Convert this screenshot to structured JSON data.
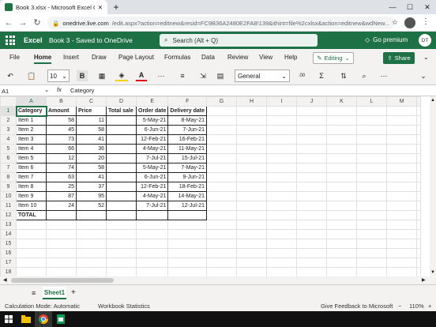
{
  "browser": {
    "tab_title": "Book 3.xlsx - Microsoft Excel Online",
    "new_tab_symbol": "+",
    "url_host": "onedrive.live.com",
    "url_path": "/edit.aspx?action=editnew&resid=FC9B36A2480E2FA8!139&ithint=file%2cxlsx&action=editnew&wdNew..."
  },
  "office": {
    "app_name": "Excel",
    "doc_name": "Book 3 - Saved to OneDrive",
    "search_placeholder": "Search (Alt + Q)",
    "premium_label": "Go premium",
    "avatar_initials": "DT"
  },
  "ribbon": {
    "tabs": [
      "File",
      "Home",
      "Insert",
      "Draw",
      "Page Layout",
      "Formulas",
      "Data",
      "Review",
      "View",
      "Help"
    ],
    "active_tab": "Home",
    "editing_label": "Editing",
    "share_label": "Share",
    "font_size": "10",
    "number_format": "General",
    "bold_label": "B"
  },
  "formula_bar": {
    "name_box": "A1",
    "fx_label": "fx",
    "content": "Category"
  },
  "grid": {
    "columns": [
      "A",
      "B",
      "C",
      "D",
      "E",
      "F",
      "G",
      "H",
      "I",
      "J",
      "K",
      "L",
      "M"
    ],
    "header_row": [
      "Category",
      "Amount",
      "Price",
      "Total sale",
      "Order date",
      "Delivery date"
    ],
    "rows": [
      [
        "Item 1",
        "58",
        "11",
        "",
        "5-May-21",
        "8-May-21"
      ],
      [
        "Item 2",
        "45",
        "58",
        "",
        "6-Jun-21",
        "7-Jun-21"
      ],
      [
        "Item 3",
        "73",
        "41",
        "",
        "12-Feb-21",
        "16-Feb-21"
      ],
      [
        "Item 4",
        "66",
        "36",
        "",
        "4-May-21",
        "11-May-21"
      ],
      [
        "Item 5",
        "12",
        "20",
        "",
        "7-Jul-21",
        "15-Jul-21"
      ],
      [
        "Item 6",
        "74",
        "58",
        "",
        "5-May-21",
        "7-May-21"
      ],
      [
        "Item 7",
        "63",
        "41",
        "",
        "6-Jun-21",
        "9-Jun-21"
      ],
      [
        "Item 8",
        "25",
        "37",
        "",
        "12-Feb-21",
        "18-Feb-21"
      ],
      [
        "Item 9",
        "87",
        "95",
        "",
        "4-May-21",
        "14-May-21"
      ],
      [
        "Item 10",
        "24",
        "52",
        "",
        "7-Jul-21",
        "12-Jul-21"
      ]
    ],
    "total_label": "TOTAL",
    "row_numbers": [
      "1",
      "2",
      "3",
      "4",
      "5",
      "6",
      "7",
      "8",
      "9",
      "10",
      "11",
      "12",
      "13",
      "14",
      "15",
      "16",
      "17",
      "18"
    ]
  },
  "sheets": {
    "active": "Sheet1",
    "add_symbol": "+"
  },
  "status": {
    "calc_mode": "Calculation Mode: Automatic",
    "workbook_stats": "Workbook Statistics",
    "feedback": "Give Feedback to Microsoft",
    "zoom": "110%"
  },
  "colors": {
    "excel_green": "#1e7145",
    "ribbon_bg": "#f3f2f1"
  }
}
